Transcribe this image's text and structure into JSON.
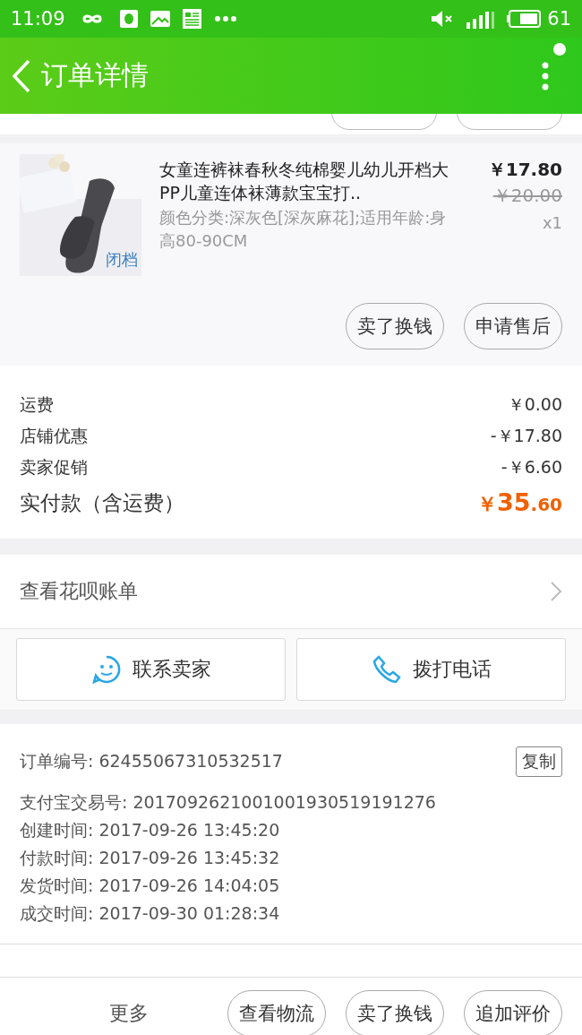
{
  "status_bar": {
    "time": "11:09",
    "battery": "61"
  },
  "header": {
    "title": "订单详情"
  },
  "product": {
    "title": "女童连裤袜春秋冬纯棉婴儿幼儿开档大PP儿童连体袜薄款宝宝打..",
    "spec": "颜色分类:深灰色[深灰麻花];适用年龄:身高80-90CM",
    "image_tag": "闭档",
    "price": "￥17.80",
    "original_price": "￥20.00",
    "quantity": "x1",
    "buttons": [
      "卖了换钱",
      "申请售后"
    ]
  },
  "costs": [
    {
      "label": "运费",
      "value": "￥0.00"
    },
    {
      "label": "店铺优惠",
      "value": "-￥17.80"
    },
    {
      "label": "卖家促销",
      "value": "-￥6.60"
    }
  ],
  "total": {
    "label": "实付款（含运费）",
    "currency": "￥",
    "integer": "35",
    "decimal": ".60"
  },
  "huabei": {
    "label": "查看花呗账单"
  },
  "contact_buttons": [
    {
      "kind": "chat",
      "label": "联系卖家"
    },
    {
      "kind": "phone",
      "label": "拨打电话"
    }
  ],
  "order_info": [
    {
      "label": "订单编号:",
      "value": "62455067310532517",
      "copy": "复制"
    },
    {
      "label": "支付宝交易号:",
      "value": "2017092621001001930519191276"
    },
    {
      "label": "创建时间:",
      "value": "2017-09-26 13:45:20"
    },
    {
      "label": "付款时间:",
      "value": "2017-09-26 13:45:32"
    },
    {
      "label": "发货时间:",
      "value": "2017-09-26 14:04:05"
    },
    {
      "label": "成交时间:",
      "value": "2017-09-30 01:28:34"
    }
  ],
  "bottom_bar": {
    "more": "更多",
    "buttons": [
      "查看物流",
      "卖了换钱",
      "追加评价"
    ]
  }
}
